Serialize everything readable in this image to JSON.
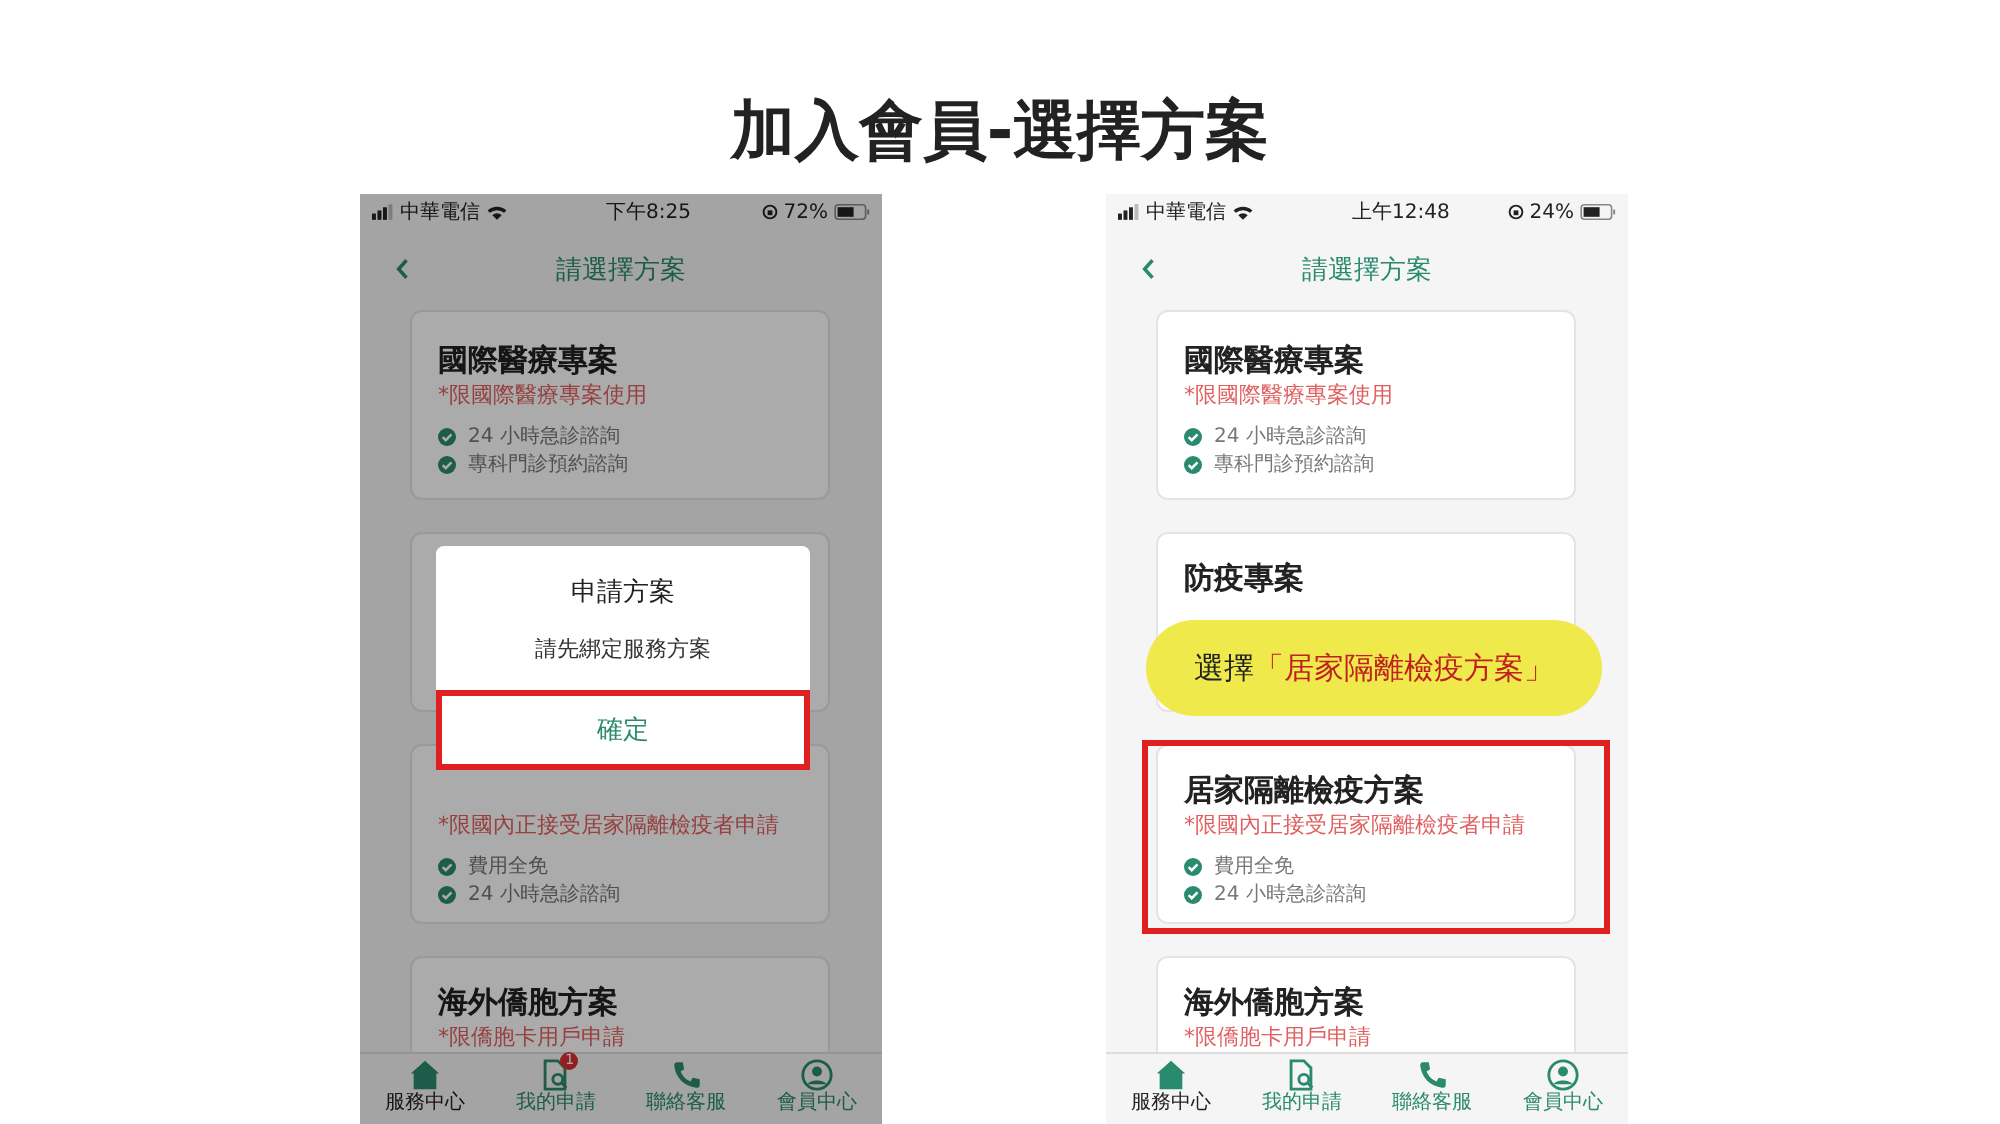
{
  "slide_title": "加入會員-選擇方案",
  "screens": [
    {
      "status_bar": {
        "carrier": "中華電信",
        "time": "下午8:25",
        "battery": "72%"
      },
      "header": {
        "title": "請選擇方案"
      },
      "plans": [
        {
          "kind": "plan",
          "title": "國際醫療專案",
          "note": "*限國際醫療專案使用",
          "features": [
            "24 小時急診諮詢",
            "專科門診預約諮詢"
          ]
        },
        {
          "kind": "covered"
        },
        {
          "kind": "plan",
          "note": "*限國內正接受居家隔離檢疫者申請",
          "features": [
            "費用全免",
            "24 小時急診諮詢"
          ]
        },
        {
          "kind": "plan",
          "title": "海外僑胞方案",
          "note": "*限僑胞卡用戶申請"
        }
      ],
      "dimmed": true,
      "dialog": {
        "title": "申請方案",
        "message": "請先綁定服務方案",
        "button": "確定",
        "highlighted": true
      },
      "tabs": [
        {
          "label": "服務中心",
          "selected": true
        },
        {
          "label": "我的申請",
          "selected": false,
          "badge": "1"
        },
        {
          "label": "聯絡客服",
          "selected": false
        },
        {
          "label": "會員中心",
          "selected": false
        }
      ]
    },
    {
      "status_bar": {
        "carrier": "中華電信",
        "time": "上午12:48",
        "battery": "24%"
      },
      "header": {
        "title": "請選擇方案"
      },
      "plans": [
        {
          "kind": "plan",
          "title": "國際醫療專案",
          "note": "*限國際醫療專案使用",
          "features": [
            "24 小時急診諮詢",
            "專科門診預約諮詢"
          ]
        },
        {
          "kind": "plan",
          "title": "防疫專案"
        },
        {
          "kind": "plan",
          "title": "居家隔離檢疫方案",
          "note": "*限國內正接受居家隔離檢疫者申請",
          "features": [
            "費用全免",
            "24 小時急診諮詢"
          ],
          "highlighted": true
        },
        {
          "kind": "plan",
          "title": "海外僑胞方案",
          "note": "*限僑胞卡用戶申請"
        }
      ],
      "dimmed": false,
      "callout": {
        "prefix": "選擇",
        "highlight": "「居家隔離檢疫方案」"
      },
      "tabs": [
        {
          "label": "服務中心",
          "selected": true
        },
        {
          "label": "我的申請",
          "selected": false
        },
        {
          "label": "聯絡客服",
          "selected": false
        },
        {
          "label": "會員中心",
          "selected": false
        }
      ]
    }
  ]
}
